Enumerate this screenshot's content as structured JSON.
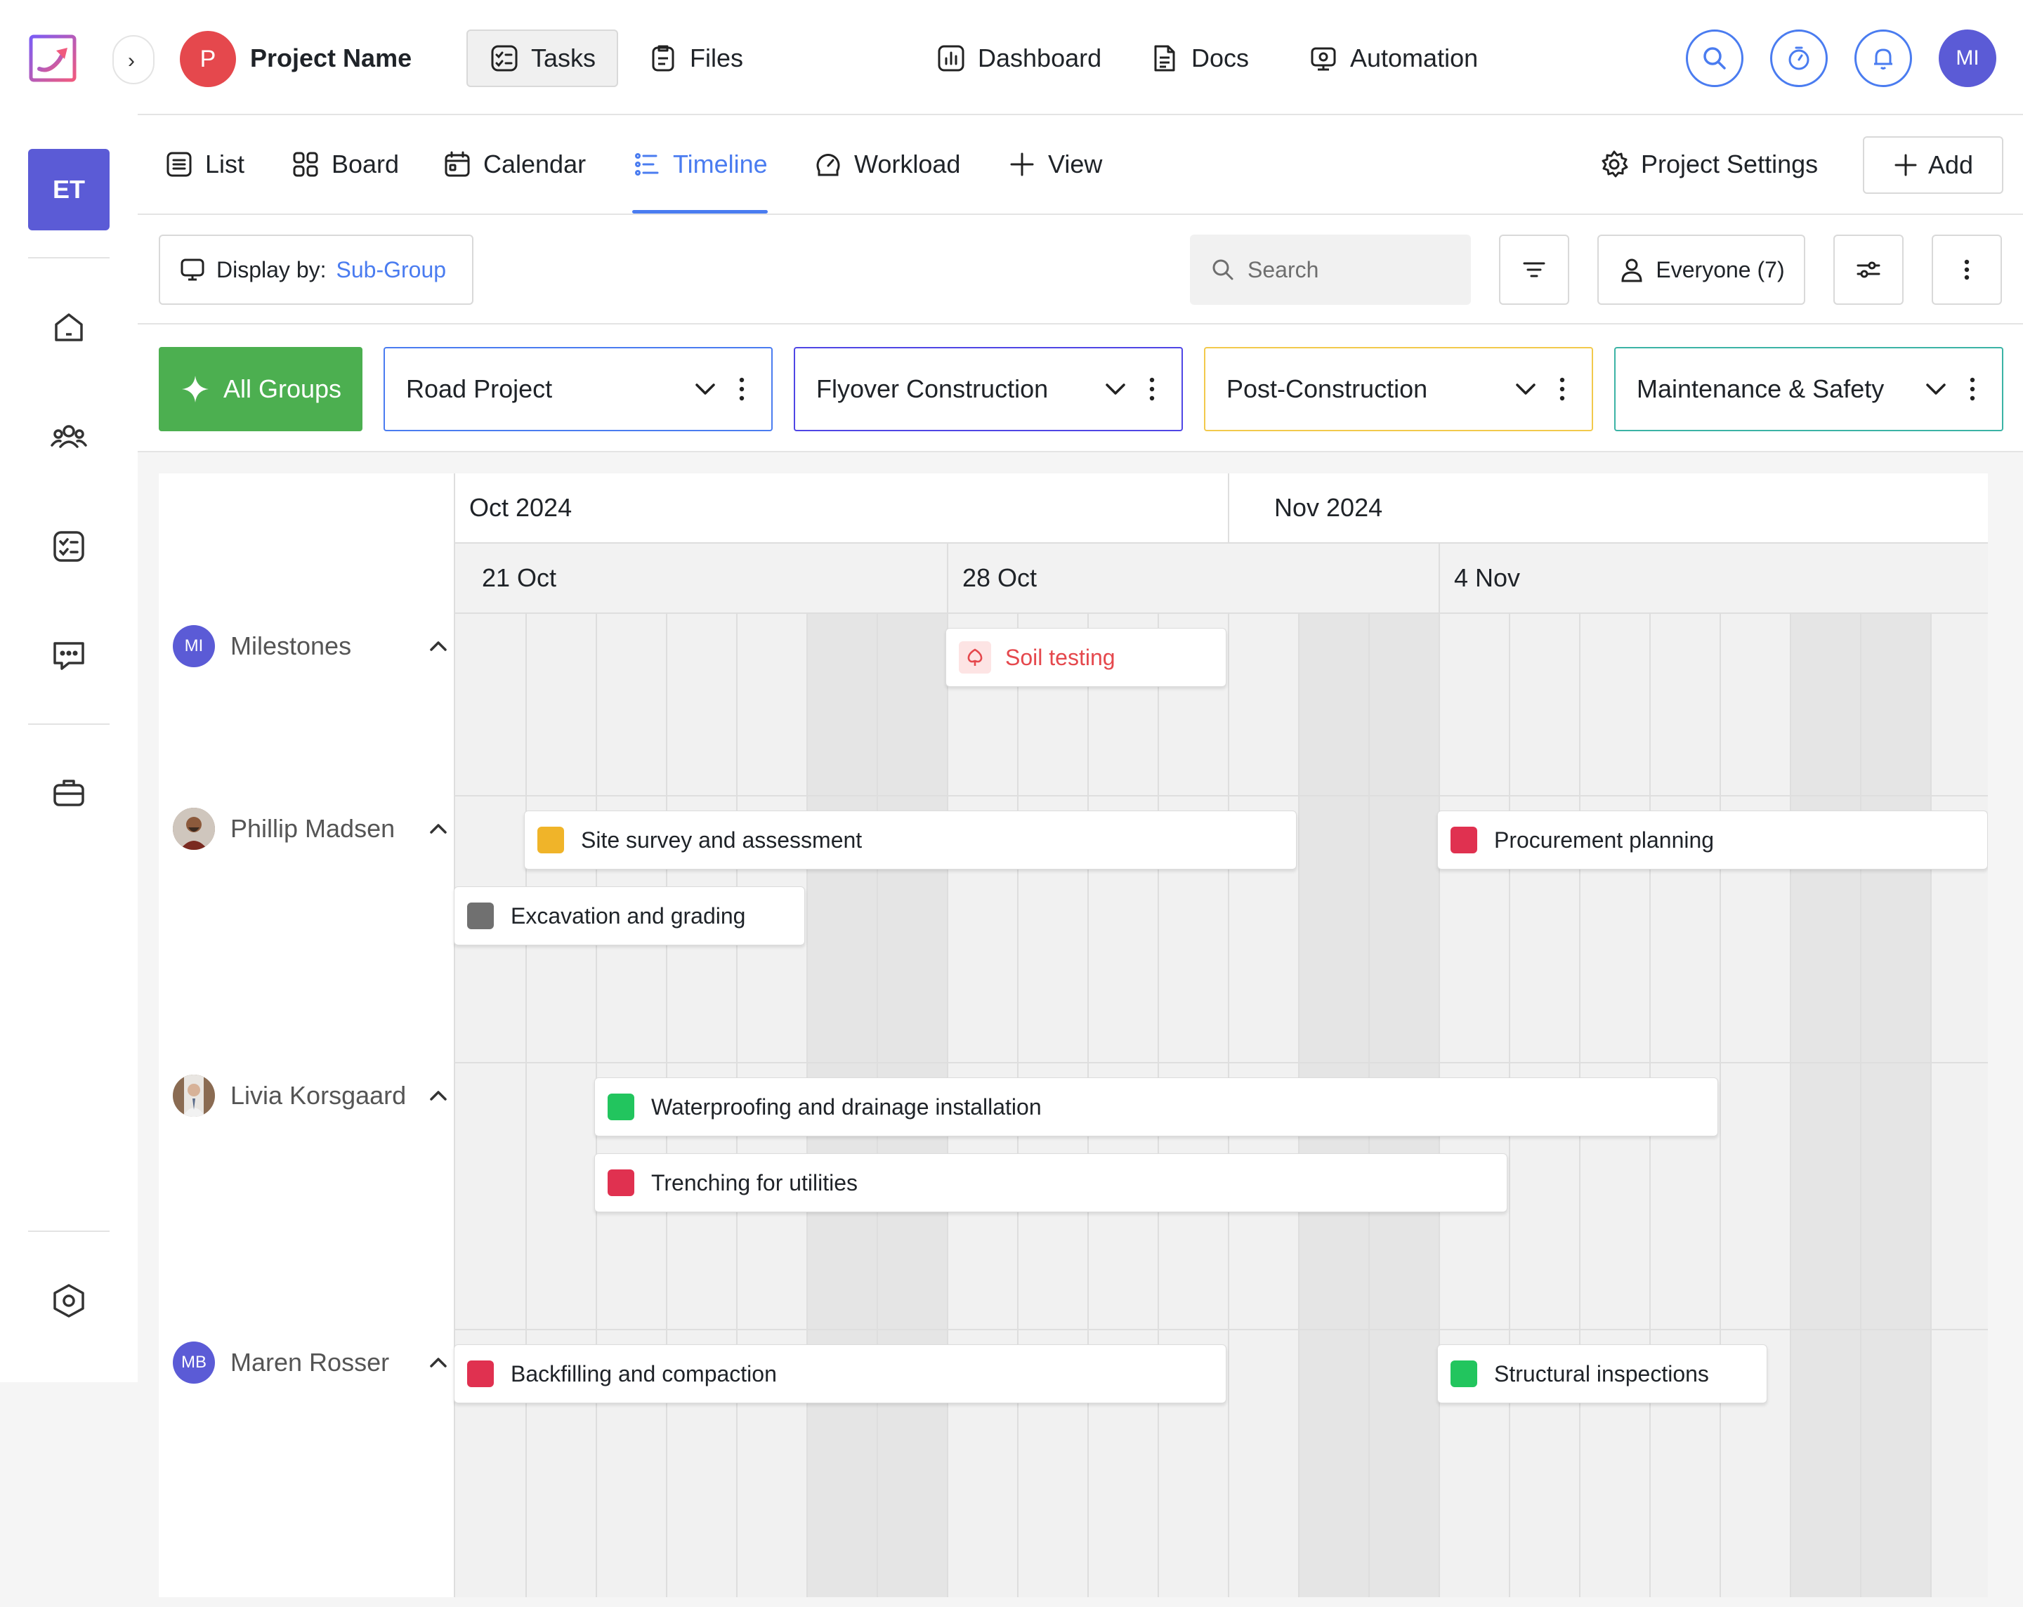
{
  "sidebar": {
    "workspace_initials": "ET",
    "nav_icons": [
      "home-icon",
      "users-icon",
      "tasks-icon",
      "chat-icon",
      "briefcase-icon",
      "settings-hex-icon"
    ]
  },
  "header": {
    "project_initial": "P",
    "project_name": "Project Name",
    "tabs": [
      {
        "label": "Tasks",
        "icon": "tasks-icon",
        "active": true
      },
      {
        "label": "Files",
        "icon": "clipboard-icon"
      },
      {
        "label": "Dashboard",
        "icon": "chart-icon"
      },
      {
        "label": "Docs",
        "icon": "doc-icon"
      },
      {
        "label": "Automation",
        "icon": "automation-icon"
      }
    ],
    "user_initials": "MI"
  },
  "views": {
    "tabs": [
      {
        "label": "List",
        "icon": "list-icon"
      },
      {
        "label": "Board",
        "icon": "board-icon"
      },
      {
        "label": "Calendar",
        "icon": "calendar-icon"
      },
      {
        "label": "Timeline",
        "icon": "timeline-icon",
        "active": true
      },
      {
        "label": "Workload",
        "icon": "workload-icon"
      },
      {
        "label": "View",
        "icon": "plus-icon"
      }
    ],
    "settings_label": "Project Settings",
    "add_label": "Add"
  },
  "toolbar": {
    "display_by_label": "Display by:",
    "display_by_value": "Sub-Group",
    "search_placeholder": "Search",
    "everyone_label": "Everyone (7)"
  },
  "groups": {
    "all_label": "All Groups",
    "items": [
      {
        "label": "Road Project",
        "color": "#4a7cf0"
      },
      {
        "label": "Flyover Construction",
        "color": "#4f46e5"
      },
      {
        "label": "Post-Construction",
        "color": "#f2c94c"
      },
      {
        "label": "Maintenance & Safety",
        "color": "#3bb3a5"
      }
    ]
  },
  "timeline": {
    "months": [
      "Oct 2024",
      "Nov 2024"
    ],
    "weeks": [
      "21 Oct",
      "28 Oct",
      "4 Nov"
    ],
    "rows": [
      {
        "name": "Milestones",
        "initials": "MI"
      },
      {
        "name": "Phillip Madsen",
        "initials": ""
      },
      {
        "name": "Livia Korsgaard",
        "initials": ""
      },
      {
        "name": "Maren Rosser",
        "initials": "MB"
      }
    ],
    "tasks": [
      {
        "label": "Soil testing",
        "type": "milestone",
        "color": "#e5484d"
      },
      {
        "label": "Site survey and assessment",
        "color": "#f0b429"
      },
      {
        "label": "Procurement planning",
        "color": "#e03150"
      },
      {
        "label": "Excavation and grading",
        "color": "#707070"
      },
      {
        "label": "Waterproofing and drainage installation",
        "color": "#22c55e"
      },
      {
        "label": "Trenching for utilities",
        "color": "#e03150"
      },
      {
        "label": "Backfilling and compaction",
        "color": "#e03150"
      },
      {
        "label": "Structural inspections",
        "color": "#22c55e"
      }
    ]
  }
}
